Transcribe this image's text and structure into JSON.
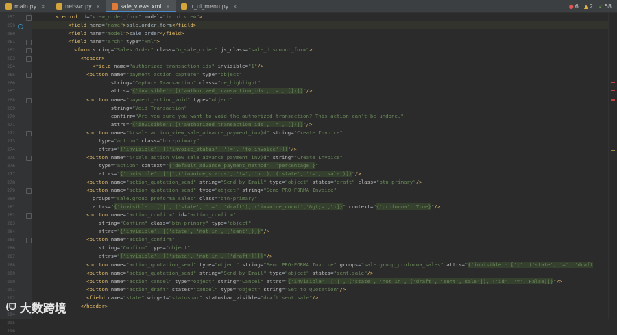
{
  "tabs": [
    {
      "label": "main.py",
      "icon": "python-file-icon",
      "color": "#d4a63a",
      "active": false
    },
    {
      "label": "netsvc.py",
      "icon": "python-file-icon",
      "color": "#d4a63a",
      "active": false
    },
    {
      "label": "sale_views.xml",
      "icon": "xml-file-icon",
      "color": "#e07b39",
      "active": true
    },
    {
      "label": "ir_ui_menu.py",
      "icon": "python-file-icon",
      "color": "#d4a63a",
      "active": false
    }
  ],
  "inspections": {
    "errors": "6",
    "warnings": "2",
    "ok": "58"
  },
  "gutter_numbers": [
    "257",
    "259",
    "260",
    "261",
    "262",
    "263",
    "264",
    "265",
    "266",
    "267",
    "268",
    "269",
    "270",
    "271",
    "272",
    "273",
    "274",
    "275",
    "276",
    "277",
    "278",
    "279",
    "280",
    "281",
    "282",
    "283",
    "284",
    "285",
    "286",
    "287",
    "288",
    "289",
    "290",
    "291",
    "292",
    "293",
    "294",
    "295",
    "296"
  ],
  "code_lines": [
    "        <record id=\"view_order_form\" model=\"ir.ui.view\">",
    "            <field name=\"name\">sale.order.form</field>",
    "            <field name=\"model\">sale.order</field>",
    "            <field name=\"arch\" type=\"xml\">",
    "              <form string=\"Sales Order\" class=\"o_sale_order\" js_class=\"sale_discount_form\">",
    "                <header>",
    "                    <field name=\"authorized_transaction_ids\" invisible=\"1\"/>",
    "                  <button name=\"payment_action_capture\" type=\"object\"",
    "                          string=\"Capture Transaction\" class=\"oe_highlight\"",
    "                          attrs=\"{'invisible': [('authorized_transaction_ids', '=', [])]}\"/>",
    "                  <button name=\"payment_action_void\" type=\"object\"",
    "                          string=\"Void Transaction\"",
    "                          confirm=\"Are you sure you want to void the authorized transaction? This action can't be undone.\"",
    "                          attrs=\"{'invisible': [('authorized_transaction_ids', '=', [])]}\"/>",
    "                  <button name=\"%(sale.action_view_sale_advance_payment_inv)d\" string=\"Create Invoice\"",
    "                      type=\"action\" class=\"btn-primary\"",
    "                      attrs=\"{'invisible': [('invoice_status', '!=', 'to invoice')]}\"/>",
    "                  <button name=\"%(sale.action_view_sale_advance_payment_inv)d\" string=\"Create Invoice\"",
    "                      type=\"action\" context=\"{'default_advance_payment_method': 'percentage'}\"",
    "                      attrs=\"{'invisible': ['|',('invoice_status', '!=', 'no'), ('state', '!=', 'sale')]}\"/>",
    "                  <button name=\"action_quotation_send\" string=\"Send by Email\" type=\"object\" states=\"draft\" class=\"btn-primary\"/>",
    "                  <button name=\"action_quotation_send\" type=\"object\" string=\"Send PRO-FORMA Invoice\"",
    "                    groups=\"sale.group_proforma_sales\" class=\"btn-primary\"",
    "                    attrs=\"{'invisible': ['|', ('state', '!=', 'draft'), ('invoice_count','&gt;=',1)]}\" context=\"{'proforma': True}\"/>",
    "                  <button name=\"action_confirm\" id=\"action_confirm\"",
    "                      string=\"Confirm\" class=\"btn-primary\" type=\"object\"",
    "                      attrs=\"{'invisible': [('state', 'not in', ['sent'])]}\"/>",
    "                  <button name=\"action_confirm\"",
    "                      string=\"Confirm\" type=\"object\"",
    "                      attrs=\"{'invisible': [('state', 'not in', ['draft'])]}\"/>",
    "                  <button name=\"action_quotation_send\" type=\"object\" string=\"Send PRO-FORMA Invoice\" groups=\"sale.group_proforma_sales\" attrs=\"{'invisible': ['|', ('state', '=', 'draft'",
    "                  <button name=\"action_quotation_send\" string=\"Send by Email\" type=\"object\" states=\"sent,sale\"/>",
    "                  <button name=\"action_cancel\" type=\"object\" string=\"Cancel\" attrs=\"{'invisible': ['|', ('state', 'not in', ['draft', 'sent','sale']), ('id', '=', False)]}\"/>",
    "                  <button name=\"action_draft\" states=\"cancel\" type=\"object\" string=\"Set to Quotation\"/>",
    "                  <field name=\"state\" widget=\"statusbar\" statusbar_visible=\"draft,sent,sale\"/>",
    "                </header>"
  ],
  "watermark": {
    "logo": "(ᗜ",
    "text": "大数跨境"
  },
  "colors": {
    "tag": "#e8bf6a",
    "attr": "#bababa",
    "value": "#6a8759",
    "text": "#a9b7c6",
    "background": "#2b2b2b"
  }
}
